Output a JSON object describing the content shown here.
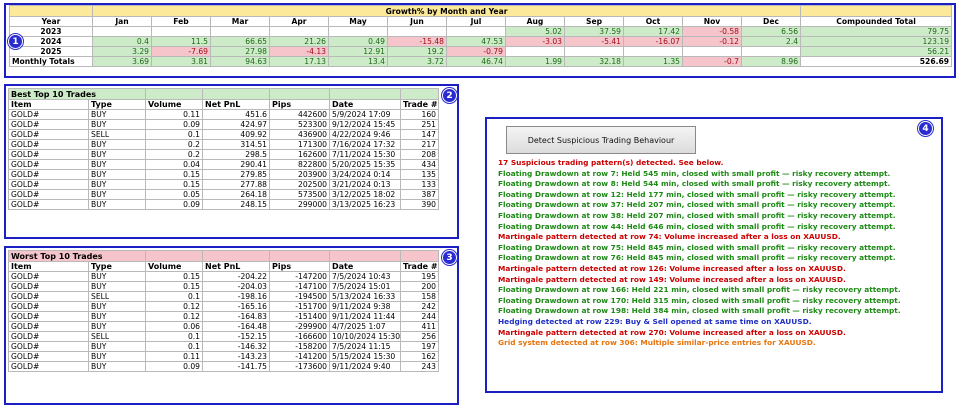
{
  "growth": {
    "title": "Growth% by Month and Year",
    "year_label": "Year",
    "months": [
      "Jan",
      "Feb",
      "Mar",
      "Apr",
      "May",
      "Jun",
      "Jul",
      "Aug",
      "Sep",
      "Oct",
      "Nov",
      "Dec"
    ],
    "compounded_label": "Compounded Total",
    "rows": [
      {
        "year": "2023",
        "values": [
          "",
          "",
          "",
          "",
          "",
          "",
          "",
          "5.02",
          "37.59",
          "17.42",
          "-0.58",
          "6.56"
        ],
        "total": "79.75"
      },
      {
        "year": "2024",
        "values": [
          "0.4",
          "11.5",
          "66.65",
          "21.26",
          "0.49",
          "-15.48",
          "47.53",
          "-3.03",
          "-5.41",
          "-16.07",
          "-0.12",
          "2.4"
        ],
        "total": "123.19"
      },
      {
        "year": "2025",
        "values": [
          "3.29",
          "-7.69",
          "27.98",
          "-4.13",
          "12.91",
          "19.2",
          "-0.79",
          "",
          "",
          "",
          "",
          ""
        ],
        "total": "56.21"
      }
    ],
    "monthly": {
      "label": "Monthly Totals",
      "values": [
        "3.69",
        "3.81",
        "94.63",
        "17.13",
        "13.4",
        "3.72",
        "46.74",
        "1.99",
        "32.18",
        "1.35",
        "-0.7",
        "8.96"
      ],
      "total": "526.69"
    }
  },
  "badges": {
    "growth": "1",
    "best": "2",
    "worst": "3",
    "suspicious": "4"
  },
  "columns": [
    "Item",
    "Type",
    "Volume",
    "Net PnL",
    "Pips",
    "Date",
    "Trade #"
  ],
  "best": {
    "title": "Best Top 10 Trades",
    "rows": [
      [
        "GOLD#",
        "BUY",
        "0.11",
        "451.6",
        "442600",
        "5/9/2024 17:09",
        "160"
      ],
      [
        "GOLD#",
        "BUY",
        "0.09",
        "424.97",
        "523300",
        "9/12/2024 15:45",
        "251"
      ],
      [
        "GOLD#",
        "SELL",
        "0.1",
        "409.92",
        "436900",
        "4/22/2024 9:46",
        "147"
      ],
      [
        "GOLD#",
        "BUY",
        "0.2",
        "314.51",
        "171300",
        "7/16/2024 17:32",
        "217"
      ],
      [
        "GOLD#",
        "BUY",
        "0.2",
        "298.5",
        "162600",
        "7/11/2024 15:30",
        "208"
      ],
      [
        "GOLD#",
        "BUY",
        "0.04",
        "290.41",
        "822800",
        "5/20/2025 15:35",
        "434"
      ],
      [
        "GOLD#",
        "BUY",
        "0.15",
        "279.85",
        "203900",
        "3/24/2024 0:14",
        "135"
      ],
      [
        "GOLD#",
        "BUY",
        "0.15",
        "277.88",
        "202500",
        "3/21/2024 0:13",
        "133"
      ],
      [
        "GOLD#",
        "BUY",
        "0.05",
        "264.18",
        "573500",
        "3/12/2025 18:02",
        "387"
      ],
      [
        "GOLD#",
        "BUY",
        "0.09",
        "248.15",
        "299000",
        "3/13/2025 16:23",
        "390"
      ]
    ]
  },
  "worst": {
    "title": "Worst Top 10 Trades",
    "rows": [
      [
        "GOLD#",
        "BUY",
        "0.15",
        "-204.22",
        "-147200",
        "7/5/2024 10:43",
        "195"
      ],
      [
        "GOLD#",
        "BUY",
        "0.15",
        "-204.03",
        "-147100",
        "7/5/2024 15:01",
        "200"
      ],
      [
        "GOLD#",
        "SELL",
        "0.1",
        "-198.16",
        "-194500",
        "5/13/2024 16:33",
        "158"
      ],
      [
        "GOLD#",
        "BUY",
        "0.12",
        "-165.16",
        "-151700",
        "9/11/2024 9:38",
        "242"
      ],
      [
        "GOLD#",
        "BUY",
        "0.12",
        "-164.83",
        "-151400",
        "9/11/2024 11:44",
        "244"
      ],
      [
        "GOLD#",
        "BUY",
        "0.06",
        "-164.48",
        "-299900",
        "4/7/2025 1:07",
        "411"
      ],
      [
        "GOLD#",
        "SELL",
        "0.1",
        "-152.15",
        "-166600",
        "10/10/2024 15:30",
        "256"
      ],
      [
        "GOLD#",
        "BUY",
        "0.1",
        "-146.32",
        "-158200",
        "7/5/2024 11:15",
        "197"
      ],
      [
        "GOLD#",
        "BUY",
        "0.11",
        "-143.23",
        "-141200",
        "5/15/2024 15:30",
        "162"
      ],
      [
        "GOLD#",
        "BUY",
        "0.09",
        "-141.75",
        "-173600",
        "9/11/2024 9:40",
        "243"
      ]
    ]
  },
  "suspicious": {
    "button_label": "Detect Suspicious Trading Behaviour",
    "colors": {
      "red": "#cc0000",
      "green": "#1e8a16",
      "blue": "#1f2fc4",
      "orange": "#e6740e"
    },
    "lines": [
      {
        "text": "17 Suspicious trading pattern(s) detected. See below.",
        "color": "red"
      },
      {
        "text": "Floating Drawdown at row 7: Held 545 min, closed with small profit — risky recovery attempt.",
        "color": "green"
      },
      {
        "text": "Floating Drawdown at row 8: Held 544 min, closed with small profit — risky recovery attempt.",
        "color": "green"
      },
      {
        "text": "Floating Drawdown at row 12: Held 177 min, closed with small profit — risky recovery attempt.",
        "color": "green"
      },
      {
        "text": "Floating Drawdown at row 37: Held 207 min, closed with small profit — risky recovery attempt.",
        "color": "green"
      },
      {
        "text": "Floating Drawdown at row 38: Held 207 min, closed with small profit — risky recovery attempt.",
        "color": "green"
      },
      {
        "text": "Floating Drawdown at row 44: Held 646 min, closed with small profit — risky recovery attempt.",
        "color": "green"
      },
      {
        "text": "Martingale pattern detected at row 74: Volume increased after a loss on XAUUSD.",
        "color": "red"
      },
      {
        "text": "Floating Drawdown at row 75: Held 845 min, closed with small profit — risky recovery attempt.",
        "color": "green"
      },
      {
        "text": "Floating Drawdown at row 76: Held 845 min, closed with small profit — risky recovery attempt.",
        "color": "green"
      },
      {
        "text": "Martingale pattern detected at row 126: Volume increased after a loss on XAUUSD.",
        "color": "red"
      },
      {
        "text": "Martingale pattern detected at row 149: Volume increased after a loss on XAUUSD.",
        "color": "red"
      },
      {
        "text": "Floating Drawdown at row 166: Held 221 min, closed with small profit — risky recovery attempt.",
        "color": "green"
      },
      {
        "text": "Floating Drawdown at row 170: Held 315 min, closed with small profit — risky recovery attempt.",
        "color": "green"
      },
      {
        "text": "Floating Drawdown at row 198: Held 384 min, closed with small profit — risky recovery attempt.",
        "color": "green"
      },
      {
        "text": "Hedging detected at row 229: Buy & Sell opened at same time on XAUUSD.",
        "color": "blue"
      },
      {
        "text": "Martingale pattern detected at row 270: Volume increased after a loss on XAUUSD.",
        "color": "red"
      },
      {
        "text": "Grid system detected at row 306: Multiple similar-price entries for XAUUSD.",
        "color": "orange"
      }
    ]
  }
}
